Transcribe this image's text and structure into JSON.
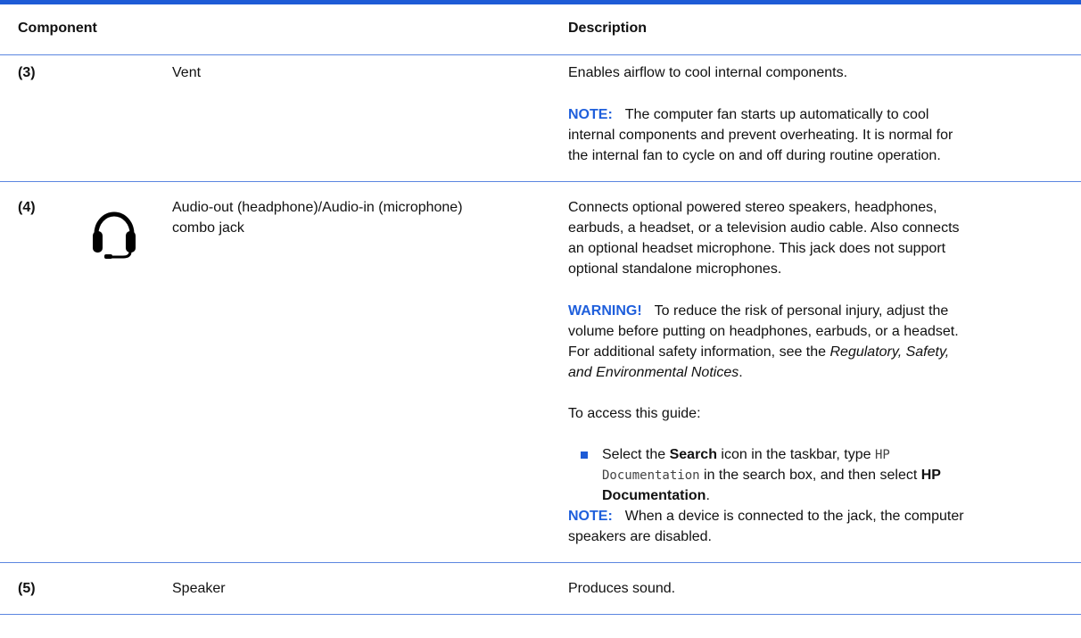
{
  "header": {
    "component": "Component",
    "description": "Description"
  },
  "rows": [
    {
      "num": "(3)",
      "name": "Vent",
      "desc": "Enables airflow to cool internal components.",
      "note_label": "NOTE:",
      "note_lines": [
        "The computer fan starts up automatically to cool",
        "internal components and prevent overheating. It is normal for",
        "the internal fan to cycle on and off during routine operation."
      ]
    },
    {
      "num": "(4)",
      "icon": "headphone-icon",
      "name_lines": [
        "Audio-out (headphone)/Audio-in (microphone)",
        "combo jack"
      ],
      "desc_lines": [
        "Connects optional powered stereo speakers, headphones,",
        "earbuds, a headset, or a television audio cable. Also connects",
        "an optional headset microphone. This jack does not support",
        "optional standalone microphones."
      ],
      "warning_label": "WARNING!",
      "warning_line1": "To reduce the risk of personal injury, adjust the",
      "warning_line2": "volume before putting on headphones, earbuds, or a headset.",
      "warning_line3_pre": "For additional safety information, see the ",
      "warning_line3_italic": "Regulatory, Safety,",
      "warning_line4_italic": "and Environmental Notices",
      "warning_line4_post": ".",
      "access": "To access this guide:",
      "step_pre": "Select the ",
      "step_bold1": "Search",
      "step_mid": " icon in the taskbar, type ",
      "step_code1": "HP",
      "step_code2": "Documentation",
      "step_post": " in the search box, and then select ",
      "step_bold2": "HP",
      "step_bold3": "Documentation",
      "step_end": ".",
      "note2_label": "NOTE:",
      "note2_line1": "When a device is connected to the jack, the computer",
      "note2_line2": "speakers are disabled."
    },
    {
      "num": "(5)",
      "name": "Speaker",
      "desc": "Produces sound."
    }
  ],
  "colors": {
    "accent": "#1e5bd6",
    "rule": "#5b86e0",
    "text": "#111111"
  }
}
